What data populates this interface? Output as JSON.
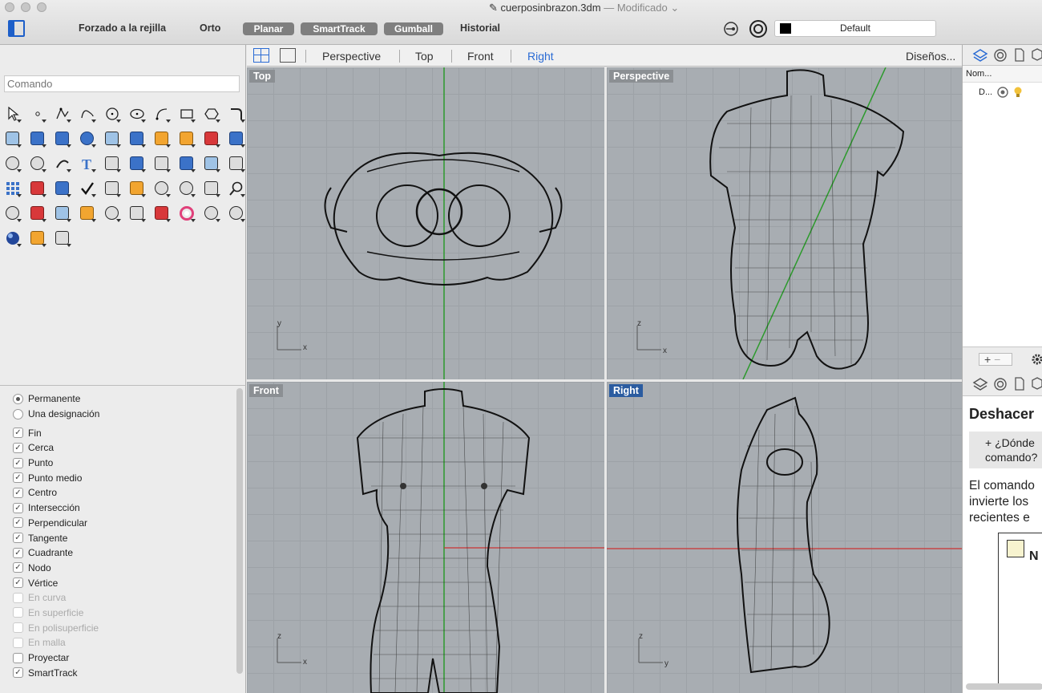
{
  "window": {
    "title": "cuerposinbrazon.3dm",
    "separator": "—",
    "modified": "Modificado"
  },
  "toolbar": {
    "grid_snap": "Forzado a la rejilla",
    "ortho": "Orto",
    "planar": "Planar",
    "smarttrack": "SmartTrack",
    "gumball": "Gumball",
    "history": "Historial",
    "layer": "Default"
  },
  "command": {
    "placeholder": "Comando"
  },
  "osnap": {
    "mode_permanent": "Permanente",
    "mode_once": "Una designación",
    "items": [
      {
        "label": "Fin",
        "checked": true,
        "enabled": true
      },
      {
        "label": "Cerca",
        "checked": true,
        "enabled": true
      },
      {
        "label": "Punto",
        "checked": true,
        "enabled": true
      },
      {
        "label": "Punto medio",
        "checked": true,
        "enabled": true
      },
      {
        "label": "Centro",
        "checked": true,
        "enabled": true
      },
      {
        "label": "Intersección",
        "checked": true,
        "enabled": true
      },
      {
        "label": "Perpendicular",
        "checked": true,
        "enabled": true
      },
      {
        "label": "Tangente",
        "checked": true,
        "enabled": true
      },
      {
        "label": "Cuadrante",
        "checked": true,
        "enabled": true
      },
      {
        "label": "Nodo",
        "checked": true,
        "enabled": true
      },
      {
        "label": "Vértice",
        "checked": true,
        "enabled": true
      },
      {
        "label": "En curva",
        "checked": false,
        "enabled": false
      },
      {
        "label": "En superficie",
        "checked": false,
        "enabled": false
      },
      {
        "label": "En polisuperficie",
        "checked": false,
        "enabled": false
      },
      {
        "label": "En malla",
        "checked": false,
        "enabled": false
      },
      {
        "label": "Proyectar",
        "checked": false,
        "enabled": true
      },
      {
        "label": "SmartTrack",
        "checked": true,
        "enabled": true
      }
    ]
  },
  "viewport_tabs": {
    "tabs": [
      "Perspective",
      "Top",
      "Front",
      "Right"
    ],
    "active": "Right",
    "layouts": "Diseños..."
  },
  "viewports": {
    "top": "Top",
    "perspective": "Perspective",
    "front": "Front",
    "right": "Right"
  },
  "axes": {
    "x": "x",
    "y": "y",
    "z": "z"
  },
  "layers_panel": {
    "column": "Nom...",
    "row_name": "D..."
  },
  "help_panel": {
    "title": "Deshacer",
    "question_line1": "+ ¿Dónde",
    "question_line2": "comando?",
    "body_line1": "El comando",
    "body_line2": "invierte los",
    "body_line3": "recientes e",
    "note_letter": "N"
  },
  "colors": {
    "accent": "#2a6bd4",
    "viewport_bg": "#a8adb2",
    "active_label": "#2b5ca0",
    "axis_red": "#c33",
    "axis_green": "#2c9a2c"
  }
}
